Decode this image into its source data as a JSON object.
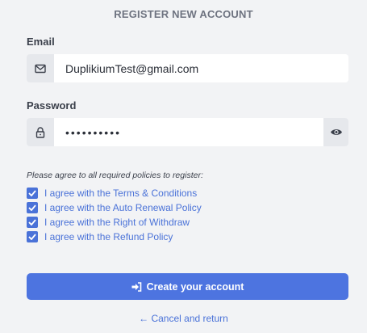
{
  "form": {
    "title": "REGISTER NEW ACCOUNT",
    "email": {
      "label": "Email",
      "value": "DuplikiumTest@gmail.com",
      "icon": "envelope-icon"
    },
    "password": {
      "label": "Password",
      "value": "••••••••••",
      "icon": "lock-icon",
      "toggle_icon": "eye-icon"
    },
    "policies_hint": "Please agree to all required policies to register:",
    "policies": [
      {
        "label": "I agree with the Terms & Conditions",
        "checked": true
      },
      {
        "label": "I agree with the Auto Renewal Policy",
        "checked": true
      },
      {
        "label": "I agree with the Right of Withdraw",
        "checked": true
      },
      {
        "label": "I agree with the Refund Policy",
        "checked": true
      }
    ],
    "submit_label": "Create your account",
    "cancel_label": "← Cancel and return"
  },
  "colors": {
    "accent": "#4d74e0",
    "link": "#4a72d8",
    "background": "#f2f3f5",
    "addon": "#e6e8ec"
  }
}
